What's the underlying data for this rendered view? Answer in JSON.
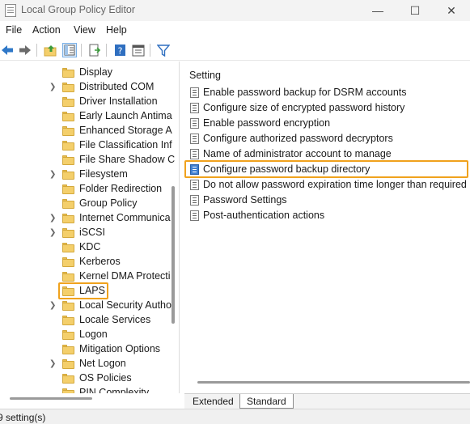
{
  "window": {
    "title": "Local Group Policy Editor",
    "controls": {
      "minimize": "—",
      "maximize": "☐",
      "close": "✕"
    }
  },
  "menu": [
    "File",
    "Action",
    "View",
    "Help"
  ],
  "toolbar_icons": [
    "back-arrow-icon",
    "forward-arrow-icon",
    "up-folder-icon",
    "show-hide-tree-icon",
    "export-list-icon",
    "help-icon",
    "properties-pane-icon",
    "filter-icon"
  ],
  "tree": [
    {
      "label": "Display",
      "expandable": false
    },
    {
      "label": "Distributed COM",
      "expandable": true
    },
    {
      "label": "Driver Installation",
      "expandable": false
    },
    {
      "label": "Early Launch Antima",
      "expandable": false
    },
    {
      "label": "Enhanced Storage A",
      "expandable": false
    },
    {
      "label": "File Classification Inf",
      "expandable": false
    },
    {
      "label": "File Share Shadow C",
      "expandable": false
    },
    {
      "label": "Filesystem",
      "expandable": true
    },
    {
      "label": "Folder Redirection",
      "expandable": false
    },
    {
      "label": "Group Policy",
      "expandable": false
    },
    {
      "label": "Internet Communica",
      "expandable": true
    },
    {
      "label": "iSCSI",
      "expandable": true
    },
    {
      "label": "KDC",
      "expandable": false
    },
    {
      "label": "Kerberos",
      "expandable": false
    },
    {
      "label": "Kernel DMA Protecti",
      "expandable": false
    },
    {
      "label": "LAPS",
      "expandable": false
    },
    {
      "label": "Local Security Autho",
      "expandable": true
    },
    {
      "label": "Locale Services",
      "expandable": false
    },
    {
      "label": "Logon",
      "expandable": false
    },
    {
      "label": "Mitigation Options",
      "expandable": false
    },
    {
      "label": "Net Logon",
      "expandable": true
    },
    {
      "label": "OS Policies",
      "expandable": false
    },
    {
      "label": "PIN Complexity",
      "expandable": false
    }
  ],
  "settings": {
    "column_header": "Setting",
    "rows": [
      {
        "label": "Enable password backup for DSRM accounts",
        "selected": false
      },
      {
        "label": "Configure size of encrypted password history",
        "selected": false
      },
      {
        "label": "Enable password encryption",
        "selected": false
      },
      {
        "label": "Configure authorized password decryptors",
        "selected": false
      },
      {
        "label": "Name of administrator account to manage",
        "selected": false
      },
      {
        "label": "Configure password backup directory",
        "selected": true
      },
      {
        "label": "Do not allow password expiration time longer than required by policy",
        "selected": false
      },
      {
        "label": "Password Settings",
        "selected": false
      },
      {
        "label": "Post-authentication actions",
        "selected": false
      }
    ]
  },
  "tabs": {
    "extended": "Extended",
    "standard": "Standard",
    "active": "Standard"
  },
  "status": "9 setting(s)",
  "colors": {
    "highlight": "#f0a21d",
    "folder": "#f4cf6b",
    "selected_icon": "#3f7fd1"
  }
}
